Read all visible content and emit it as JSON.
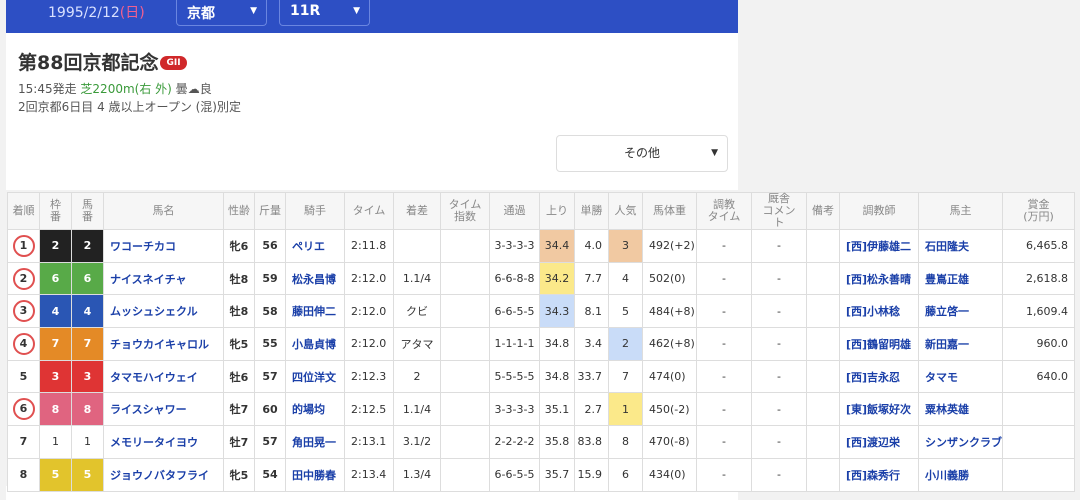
{
  "header": {
    "date": "1995/2/12",
    "weekday": "(日)",
    "venue": "京都",
    "race": "11R",
    "dropdown_icon": "triangle-down-icon"
  },
  "race": {
    "title": "第88回京都記念",
    "grade": "GII",
    "start": "15:45発走",
    "course": "芝2200m(右 外)",
    "weather_label": "曇",
    "weather_icon": "cloud-icon",
    "condition": "良",
    "details": "2回京都6日目 4 歳以上オープン (混)別定"
  },
  "filter": {
    "label": "その他"
  },
  "colors": {
    "frame": {
      "1": "#ffffff",
      "2": "#222222",
      "3": "#df3434",
      "4": "#2a56b4",
      "5": "#e2c42c",
      "6": "#58aa48",
      "7": "#e48a26",
      "8": "#e06480"
    },
    "rank1": "#fbe98a",
    "rank2": "#c9dcf8",
    "rank3": "#f1c9a2"
  },
  "columns": [
    "着順",
    "枠番",
    "馬番",
    "馬名",
    "性齢",
    "斤量",
    "騎手",
    "タイム",
    "着差",
    "タイム指数",
    "通過",
    "上り",
    "単勝",
    "人気",
    "馬体重",
    "調教タイム",
    "厩舎コメント",
    "備考",
    "調教師",
    "馬主",
    "賞金(万円)"
  ],
  "column_html": [
    "着順",
    "枠<br>番",
    "馬<br>番",
    "馬名",
    "性齢",
    "斤量",
    "騎手",
    "タイム",
    "着差",
    "タイム<br>指数",
    "通過",
    "上り",
    "単勝",
    "人気",
    "馬体重",
    "調教<br>タイム",
    "厩舎<br>コメン<br>ト",
    "備考",
    "調教師",
    "馬主",
    "賞金<br>(万円)"
  ],
  "rows": [
    {
      "pos": "1",
      "circled": true,
      "frame": "2",
      "num": "2",
      "horse": "ワコーチカコ",
      "sex_age": "牝6",
      "weight": "56",
      "jockey": "ペリエ",
      "time": "2:11.8",
      "margin": "",
      "index": "",
      "passing": "3-3-3-3",
      "last3f": "34.4",
      "last3f_rank": 3,
      "odds": "4.0",
      "pop": "3",
      "body": "492(+2)",
      "train_time": "-",
      "comment": "-",
      "note": "",
      "trainer": "[西]伊藤雄二",
      "owner": "石田隆夫",
      "prize": "6,465.8"
    },
    {
      "pos": "2",
      "circled": true,
      "frame": "6",
      "num": "6",
      "horse": "ナイスネイチャ",
      "sex_age": "牡8",
      "weight": "59",
      "jockey": "松永昌博",
      "time": "2:12.0",
      "margin": "1.1/4",
      "index": "",
      "passing": "6-6-8-8",
      "last3f": "34.2",
      "last3f_rank": 1,
      "odds": "7.7",
      "pop": "4",
      "body": "502(0)",
      "train_time": "-",
      "comment": "-",
      "note": "",
      "trainer": "[西]松永善晴",
      "owner": "豊嶌正雄",
      "prize": "2,618.8"
    },
    {
      "pos": "3",
      "circled": true,
      "frame": "4",
      "num": "4",
      "horse": "ムッシュシェクル",
      "sex_age": "牡8",
      "weight": "58",
      "jockey": "藤田伸二",
      "time": "2:12.0",
      "margin": "クビ",
      "index": "",
      "passing": "6-6-5-5",
      "last3f": "34.3",
      "last3f_rank": 2,
      "odds": "8.1",
      "pop": "5",
      "body": "484(+8)",
      "train_time": "-",
      "comment": "-",
      "note": "",
      "trainer": "[西]小林稔",
      "owner": "藤立啓一",
      "prize": "1,609.4"
    },
    {
      "pos": "4",
      "circled": true,
      "frame": "7",
      "num": "7",
      "horse": "チョウカイキャロル",
      "sex_age": "牝5",
      "weight": "55",
      "jockey": "小島貞博",
      "time": "2:12.0",
      "margin": "アタマ",
      "index": "",
      "passing": "1-1-1-1",
      "last3f": "34.8",
      "last3f_rank": 0,
      "odds": "3.4",
      "pop": "2",
      "body": "462(+8)",
      "train_time": "-",
      "comment": "-",
      "note": "",
      "trainer": "[西]鶴留明雄",
      "owner": "新田嘉一",
      "prize": "960.0"
    },
    {
      "pos": "5",
      "circled": false,
      "frame": "3",
      "num": "3",
      "horse": "タマモハイウェイ",
      "sex_age": "牡6",
      "weight": "57",
      "jockey": "四位洋文",
      "time": "2:12.3",
      "margin": "2",
      "index": "",
      "passing": "5-5-5-5",
      "last3f": "34.8",
      "last3f_rank": 0,
      "odds": "33.7",
      "pop": "7",
      "body": "474(0)",
      "train_time": "-",
      "comment": "-",
      "note": "",
      "trainer": "[西]吉永忍",
      "owner": "タマモ",
      "prize": "640.0"
    },
    {
      "pos": "6",
      "circled": true,
      "frame": "8",
      "num": "8",
      "horse": "ライスシャワー",
      "sex_age": "牡7",
      "weight": "60",
      "jockey": "的場均",
      "time": "2:12.5",
      "margin": "1.1/4",
      "index": "",
      "passing": "3-3-3-3",
      "last3f": "35.1",
      "last3f_rank": 0,
      "odds": "2.7",
      "pop": "1",
      "body": "450(-2)",
      "train_time": "-",
      "comment": "-",
      "note": "",
      "trainer": "[東]飯塚好次",
      "owner": "粟林英雄",
      "prize": ""
    },
    {
      "pos": "7",
      "circled": false,
      "frame": "1",
      "num": "1",
      "horse": "メモリータイヨウ",
      "sex_age": "牡7",
      "weight": "57",
      "jockey": "角田晃一",
      "time": "2:13.1",
      "margin": "3.1/2",
      "index": "",
      "passing": "2-2-2-2",
      "last3f": "35.8",
      "last3f_rank": 0,
      "odds": "83.8",
      "pop": "8",
      "body": "470(-8)",
      "train_time": "-",
      "comment": "-",
      "note": "",
      "trainer": "[西]渡辺栄",
      "owner": "シンザンクラブ",
      "prize": ""
    },
    {
      "pos": "8",
      "circled": false,
      "frame": "5",
      "num": "5",
      "horse": "ジョウノバタフライ",
      "sex_age": "牝5",
      "weight": "54",
      "jockey": "田中勝春",
      "time": "2:13.4",
      "margin": "1.3/4",
      "index": "",
      "passing": "6-6-5-5",
      "last3f": "35.7",
      "last3f_rank": 0,
      "odds": "15.9",
      "pop": "6",
      "body": "434(0)",
      "train_time": "-",
      "comment": "-",
      "note": "",
      "trainer": "[西]森秀行",
      "owner": "小川義勝",
      "prize": ""
    }
  ]
}
